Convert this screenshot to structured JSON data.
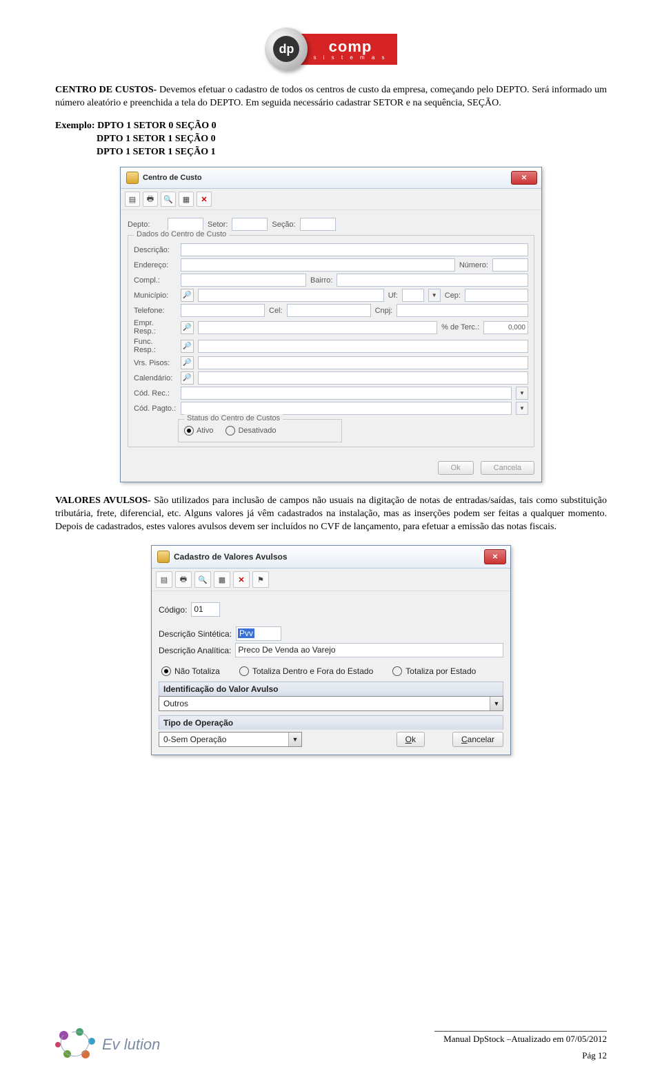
{
  "logo": {
    "dp": "dp",
    "comp": "comp",
    "sistemas": "s i s t e m a s"
  },
  "para1_bold": "CENTRO DE CUSTOS-",
  "para1": " Devemos efetuar o cadastro de todos os centros de custo da empresa, começando pelo DEPTO. Será informado um número aleatório e preenchida a tela do DEPTO. Em seguida necessário cadastrar SETOR e na sequência, SEÇÃO.",
  "exemplo_label": "Exemplo: ",
  "ex_line1": "DPTO 1 SETOR 0 SEÇÃO 0",
  "ex_line2": "DPTO 1 SETOR 1 SEÇÃO 0",
  "ex_line3": "DPTO 1 SETOR 1 SEÇÃO 1",
  "d1": {
    "title": "Centro de Custo",
    "depto": "Depto:",
    "setor": "Setor:",
    "secao": "Seção:",
    "grp": "Dados do Centro de Custo",
    "descricao": "Descrição:",
    "endereco": "Endereço:",
    "numero": "Número:",
    "compl": "Compl.:",
    "bairro": "Bairro:",
    "municipio": "Município:",
    "uf": "Uf:",
    "cep": "Cep:",
    "telefone": "Telefone:",
    "cel": "Cel:",
    "cnpj": "Cnpj:",
    "empr": "Empr. Resp.:",
    "pcterc": "% de Terc.:",
    "pcterc_val": "0,000",
    "func": "Func. Resp.:",
    "vrs": "Vrs. Pisos:",
    "calendario": "Calendário:",
    "codrec": "Cód. Rec.:",
    "codpagto": "Cód. Pagto.:",
    "status": "Status do Centro de Custos",
    "ativo": "Ativo",
    "desativado": "Desativado",
    "ok": "Ok",
    "cancela": "Cancela"
  },
  "para2_bold": "VALORES AVULSOS-",
  "para2": " São utilizados para inclusão de campos não usuais na digitação de notas de entradas/saídas, tais como substituição tributária, frete, diferencial, etc. Alguns valores já vêm cadastrados na instalação, mas as inserções podem ser feitas a qualquer momento. Depois de cadastrados, estes valores avulsos devem ser incluídos no CVF de lançamento, para efetuar a emissão das notas fiscais.",
  "d2": {
    "title": "Cadastro de Valores Avulsos",
    "codigo_lbl": "Código:",
    "codigo_val": "01",
    "ds_lbl": "Descrição Sintética:",
    "ds_val": "Pvv",
    "da_lbl": "Descrição Analítica:",
    "da_val": "Preco De Venda ao Varejo",
    "r1": "Não Totaliza",
    "r2": "Totaliza Dentro e Fora do Estado",
    "r3": "Totaliza por Estado",
    "ident": "Identificação do Valor Avulso",
    "ident_val": "Outros",
    "tipo": "Tipo de Operação",
    "tipo_val": "0-Sem Operação",
    "ok": "Ok",
    "cancelar": "Cancelar"
  },
  "footer": {
    "manual": "Manual DpStock –Atualizado em 07/05/2012",
    "page": "Pág 12",
    "ev": "Ev    lution"
  }
}
